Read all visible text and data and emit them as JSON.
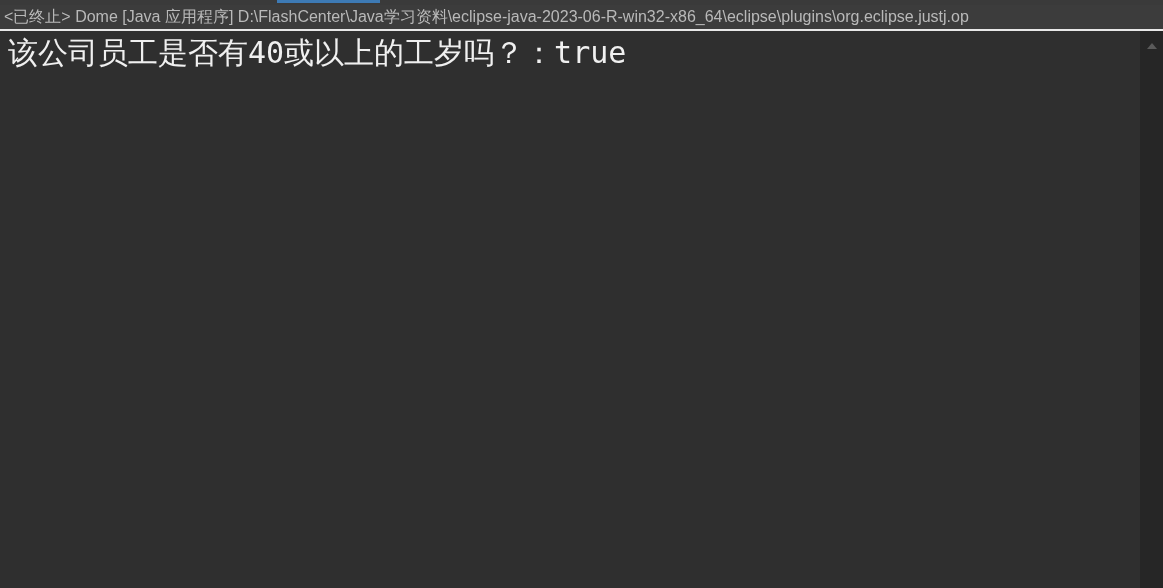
{
  "console": {
    "title": "<已终止> Dome [Java 应用程序] D:\\FlashCenter\\Java学习资料\\eclipse-java-2023-06-R-win32-x86_64\\eclipse\\plugins\\org.eclipse.justj.op",
    "lines": [
      "该公司员工是否有40或以上的工岁吗？：true"
    ]
  }
}
